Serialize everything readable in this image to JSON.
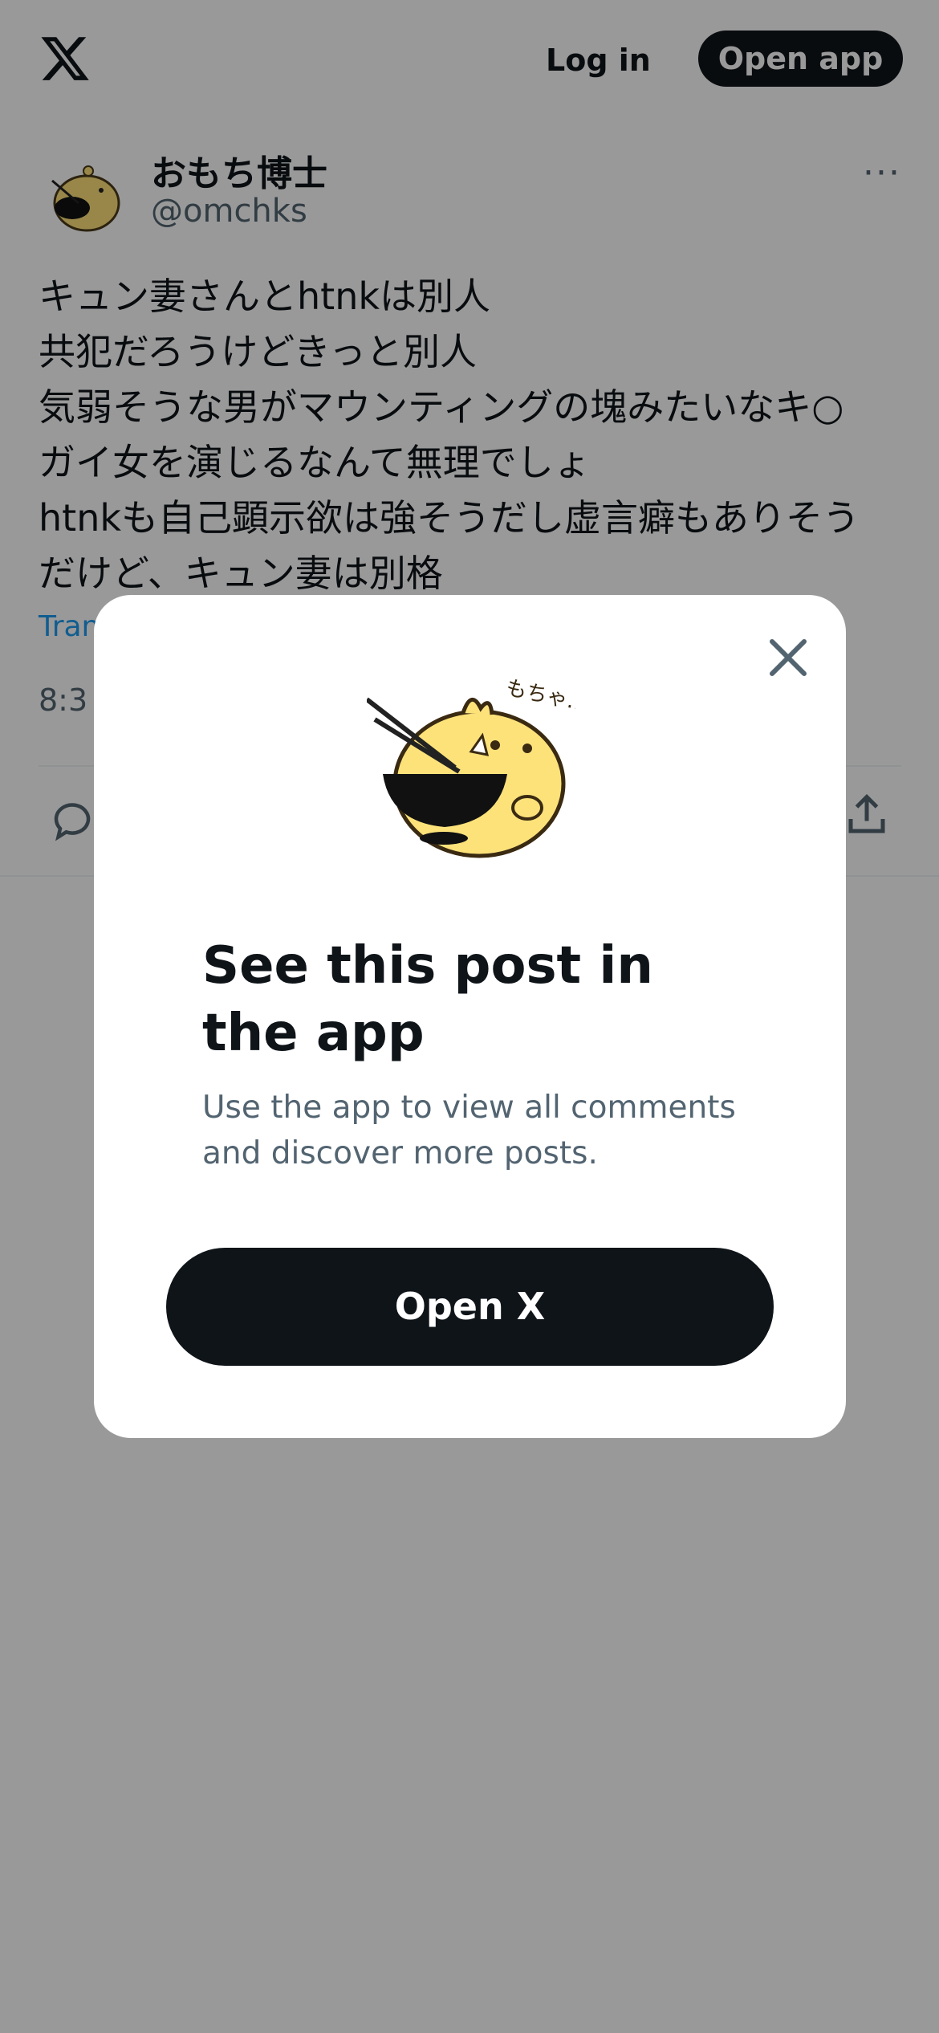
{
  "header": {
    "login_label": "Log in",
    "open_app_label": "Open app"
  },
  "post": {
    "author_name": "おもち博士",
    "author_handle": "@omchks",
    "text_lines": [
      "キュン妻さんとhtnkは別人",
      "共犯だろうけどきっと別人",
      "気弱そうな男がマウンティングの塊みたいなキ○",
      "ガイ女を演じるなんて無理でしょ",
      "htnkも自己顕示欲は強そうだし虚言癖もありそう",
      "だけど、キュン妻は別格"
    ],
    "translate_label": "Tran",
    "time_partial": "8:3",
    "more_label": "···"
  },
  "modal": {
    "title": "See this post in the app",
    "description": "Use the app to view all comments and discover more posts.",
    "button_label": "Open X",
    "mascot_caption": "もちゃ…"
  },
  "colors": {
    "brand_dark": "#0f1419",
    "secondary_text": "#536471",
    "link": "#1d9bf0",
    "overlay": "rgba(0,0,0,0.4)",
    "mascot_yellow": "#fde27a"
  },
  "icons": {
    "logo": "x-logo-icon",
    "more": "more-horizontal-icon",
    "reply": "reply-icon",
    "share": "share-icon",
    "close": "close-icon"
  }
}
